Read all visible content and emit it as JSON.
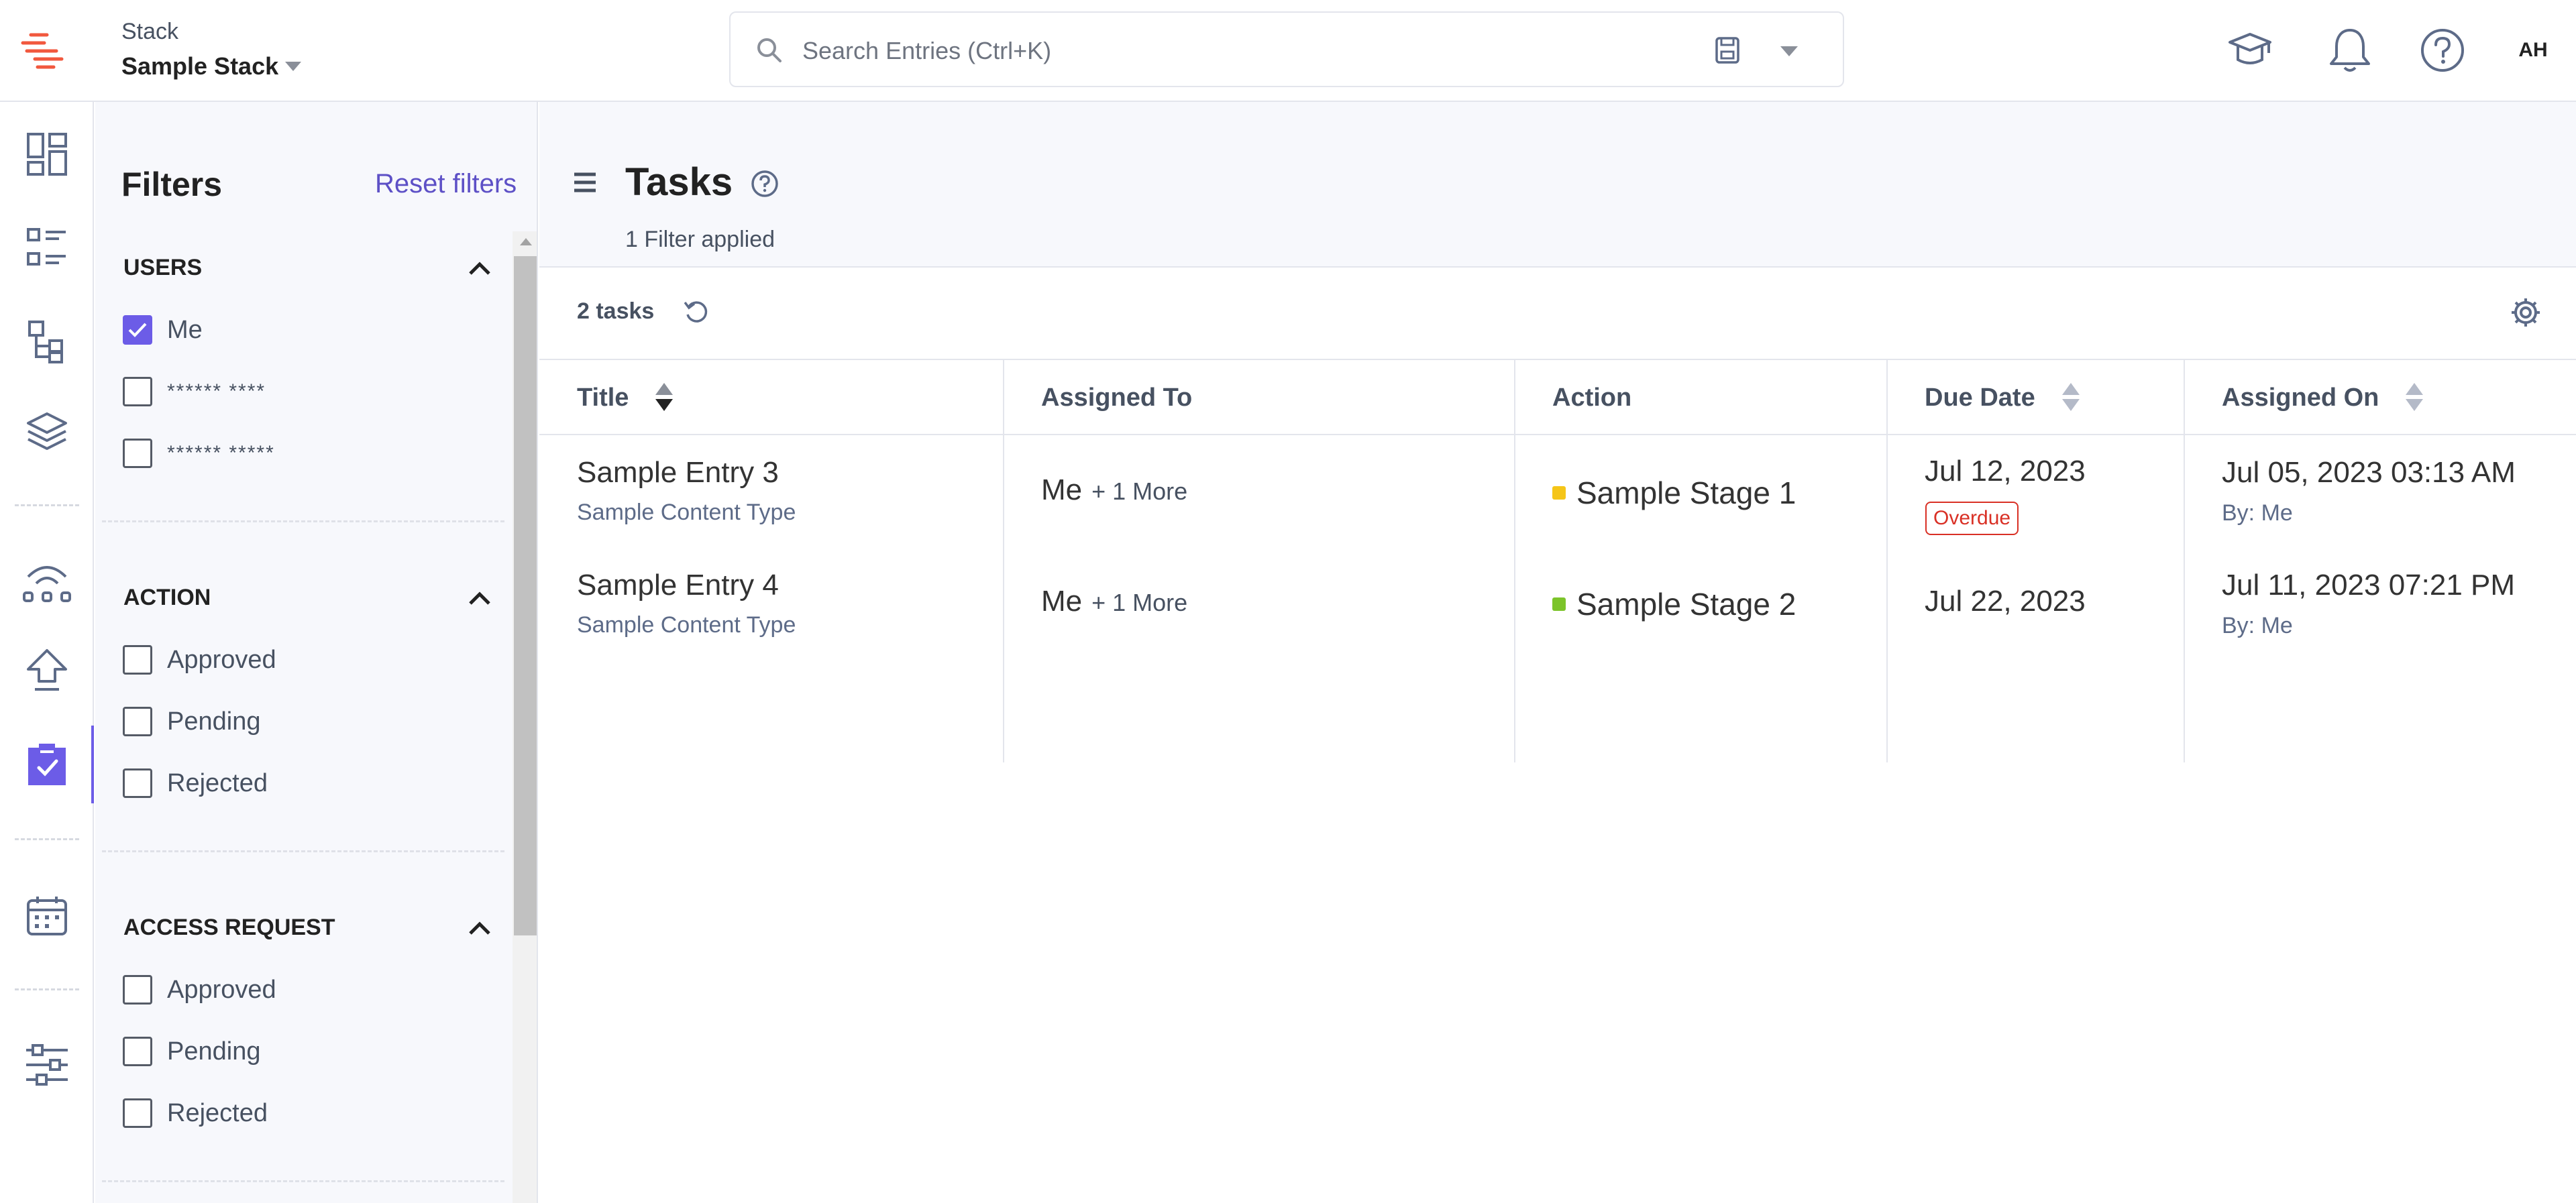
{
  "header": {
    "stack_label": "Stack",
    "stack_name": "Sample Stack",
    "search_placeholder": "Search Entries (Ctrl+K)",
    "avatar_initials": "AH",
    "icons": [
      "academy-icon",
      "bell-icon",
      "help-icon"
    ]
  },
  "leftnav": {
    "items": [
      "dashboard-icon",
      "entries-icon",
      "content-models-icon",
      "assets-icon",
      "releases-icon",
      "deploy-icon",
      "workflow-tasks-icon",
      "calendar-icon",
      "settings-sliders-icon"
    ],
    "active": "workflow-tasks-icon"
  },
  "filters": {
    "title": "Filters",
    "reset": "Reset filters",
    "sections": [
      {
        "title": "USERS",
        "items": [
          {
            "label": "Me",
            "checked": true
          },
          {
            "label": "****** ****",
            "checked": false
          },
          {
            "label": "****** *****",
            "checked": false
          }
        ]
      },
      {
        "title": "ACTION",
        "items": [
          {
            "label": "Approved",
            "checked": false
          },
          {
            "label": "Pending",
            "checked": false
          },
          {
            "label": "Rejected",
            "checked": false
          }
        ]
      },
      {
        "title": "ACCESS REQUEST",
        "items": [
          {
            "label": "Approved",
            "checked": false
          },
          {
            "label": "Pending",
            "checked": false
          },
          {
            "label": "Rejected",
            "checked": false
          }
        ]
      }
    ]
  },
  "main": {
    "title": "Tasks",
    "filter_applied": "1 Filter applied",
    "count": "2 tasks",
    "columns": [
      "Title",
      "Assigned To",
      "Action",
      "Due Date",
      "Assigned On"
    ],
    "rows": [
      {
        "title": "Sample Entry 3",
        "content_type": "Sample Content Type",
        "assigned_to": "Me",
        "more": "+ 1 More",
        "stage": "Sample Stage 1",
        "stage_color": "#f5c518",
        "due": "Jul 12, 2023",
        "overdue": "Overdue",
        "assigned_on": "Jul 05, 2023 03:13 AM",
        "by": "By: Me"
      },
      {
        "title": "Sample Entry 4",
        "content_type": "Sample Content Type",
        "assigned_to": "Me",
        "more": "+ 1 More",
        "stage": "Sample Stage 2",
        "stage_color": "#7cc42a",
        "due": "Jul 22, 2023",
        "overdue": "",
        "assigned_on": "Jul 11, 2023 07:21 PM",
        "by": "By: Me"
      }
    ]
  },
  "colors": {
    "accent": "#6c5ce7",
    "overdue": "#d93025",
    "brand": "#f1583e"
  }
}
